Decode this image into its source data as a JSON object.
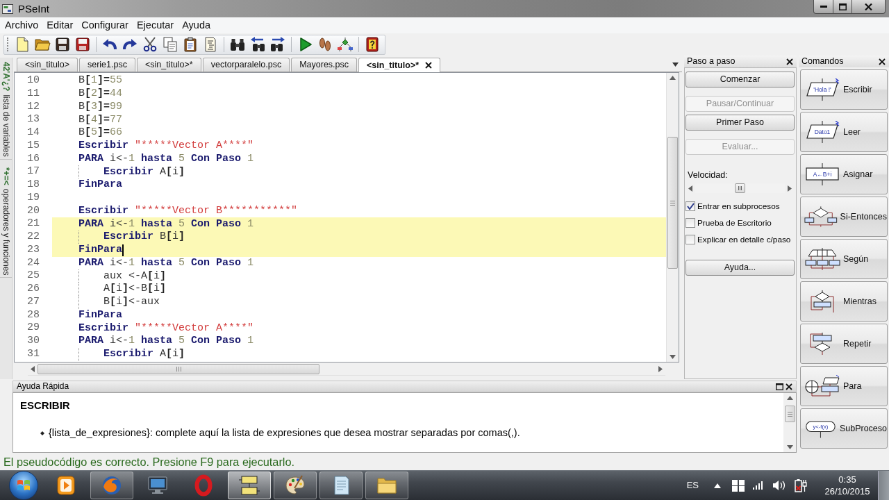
{
  "window": {
    "title": "PSeInt"
  },
  "menu": [
    "Archivo",
    "Editar",
    "Configurar",
    "Ejecutar",
    "Ayuda"
  ],
  "side_panels": [
    {
      "icon_text": "42'A'¿?",
      "label": "lista de variables"
    },
    {
      "icon_text": "*+=<",
      "label": "operadores y funciones"
    }
  ],
  "tabs": [
    {
      "label": "<sin_titulo>",
      "selected": false
    },
    {
      "label": "serie1.psc",
      "selected": false
    },
    {
      "label": "<sin_titulo>*",
      "selected": false
    },
    {
      "label": "vectorparalelo.psc",
      "selected": false
    },
    {
      "label": "Mayores.psc",
      "selected": false
    },
    {
      "label": "<sin_titulo>*",
      "selected": true
    }
  ],
  "editor": {
    "lines": [
      {
        "number": "10",
        "highlighted": false,
        "caret": false,
        "tokens": [
          {
            "text": "B",
            "kind": "plain"
          },
          {
            "text": "[",
            "kind": "operator"
          },
          {
            "text": "1",
            "kind": "number"
          },
          {
            "text": "]=",
            "kind": "operator"
          },
          {
            "text": "55",
            "kind": "number"
          }
        ]
      },
      {
        "number": "11",
        "highlighted": false,
        "caret": false,
        "tokens": [
          {
            "text": "B",
            "kind": "plain"
          },
          {
            "text": "[",
            "kind": "operator"
          },
          {
            "text": "2",
            "kind": "number"
          },
          {
            "text": "]=",
            "kind": "operator"
          },
          {
            "text": "44",
            "kind": "number"
          }
        ]
      },
      {
        "number": "12",
        "highlighted": false,
        "caret": false,
        "tokens": [
          {
            "text": "B",
            "kind": "plain"
          },
          {
            "text": "[",
            "kind": "operator"
          },
          {
            "text": "3",
            "kind": "number"
          },
          {
            "text": "]=",
            "kind": "operator"
          },
          {
            "text": "99",
            "kind": "number"
          }
        ]
      },
      {
        "number": "13",
        "highlighted": false,
        "caret": false,
        "tokens": [
          {
            "text": "B",
            "kind": "plain"
          },
          {
            "text": "[",
            "kind": "operator"
          },
          {
            "text": "4",
            "kind": "number"
          },
          {
            "text": "]=",
            "kind": "operator"
          },
          {
            "text": "77",
            "kind": "number"
          }
        ]
      },
      {
        "number": "14",
        "highlighted": false,
        "caret": false,
        "tokens": [
          {
            "text": "B",
            "kind": "plain"
          },
          {
            "text": "[",
            "kind": "operator"
          },
          {
            "text": "5",
            "kind": "number"
          },
          {
            "text": "]=",
            "kind": "operator"
          },
          {
            "text": "66",
            "kind": "number"
          }
        ]
      },
      {
        "number": "15",
        "highlighted": false,
        "caret": false,
        "tokens": [
          {
            "text": "Escribir",
            "kind": "keyword"
          },
          {
            "text": " \"*****Vector A****\"",
            "kind": "string"
          }
        ]
      },
      {
        "number": "16",
        "highlighted": false,
        "caret": false,
        "tokens": [
          {
            "text": "PARA",
            "kind": "keyword"
          },
          {
            "text": " i<-",
            "kind": "plain"
          },
          {
            "text": "1",
            "kind": "number"
          },
          {
            "text": " hasta",
            "kind": "keyword"
          },
          {
            "text": " 5",
            "kind": "number"
          },
          {
            "text": " Con Paso",
            "kind": "keyword"
          },
          {
            "text": " 1",
            "kind": "number"
          }
        ],
        "children": [
          {
            "number": "17",
            "highlighted": false,
            "caret": false,
            "tokens": [
              {
                "text": "Escribir",
                "kind": "keyword"
              },
              {
                "text": " A",
                "kind": "plain"
              },
              {
                "text": "[",
                "kind": "operator"
              },
              {
                "text": "i",
                "kind": "plain"
              },
              {
                "text": "]",
                "kind": "operator"
              }
            ]
          }
        ]
      },
      {
        "number": "18",
        "highlighted": false,
        "caret": false,
        "tokens": [
          {
            "text": "FinPara",
            "kind": "keyword"
          }
        ]
      },
      {
        "number": "19",
        "highlighted": false,
        "caret": false
      },
      {
        "number": "20",
        "highlighted": false,
        "caret": false,
        "tokens": [
          {
            "text": "Escribir",
            "kind": "keyword"
          },
          {
            "text": " \"*****Vector B***********\"",
            "kind": "string"
          }
        ]
      },
      {
        "number": "21",
        "highlighted": true,
        "caret": false,
        "tokens": [
          {
            "text": "PARA",
            "kind": "keyword"
          },
          {
            "text": " i<-",
            "kind": "plain"
          },
          {
            "text": "1",
            "kind": "number"
          },
          {
            "text": " hasta",
            "kind": "keyword"
          },
          {
            "text": " 5",
            "kind": "number"
          },
          {
            "text": " Con Paso",
            "kind": "keyword"
          },
          {
            "text": " 1",
            "kind": "number"
          }
        ],
        "children": [
          {
            "number": "22",
            "highlighted": true,
            "caret": false,
            "tokens": [
              {
                "text": "Escribir",
                "kind": "keyword"
              },
              {
                "text": " B",
                "kind": "plain"
              },
              {
                "text": "[",
                "kind": "operator"
              },
              {
                "text": "i",
                "kind": "plain"
              },
              {
                "text": "]",
                "kind": "operator"
              }
            ]
          }
        ]
      },
      {
        "number": "23",
        "highlighted": true,
        "caret": true,
        "tokens": [
          {
            "text": "FinPara",
            "kind": "keyword"
          }
        ]
      },
      {
        "number": "24",
        "highlighted": false,
        "caret": false,
        "tokens": [
          {
            "text": "PARA",
            "kind": "keyword"
          },
          {
            "text": " i<-",
            "kind": "plain"
          },
          {
            "text": "1",
            "kind": "number"
          },
          {
            "text": " hasta",
            "kind": "keyword"
          },
          {
            "text": " 5",
            "kind": "number"
          },
          {
            "text": " Con Paso",
            "kind": "keyword"
          },
          {
            "text": " 1",
            "kind": "number"
          }
        ],
        "children": [
          {
            "number": "25",
            "highlighted": false,
            "caret": false,
            "tokens": [
              {
                "text": "aux <-A",
                "kind": "plain"
              },
              {
                "text": "[",
                "kind": "operator"
              },
              {
                "text": "i",
                "kind": "plain"
              },
              {
                "text": "]",
                "kind": "operator"
              }
            ]
          },
          {
            "number": "26",
            "highlighted": false,
            "caret": false,
            "tokens": [
              {
                "text": "A",
                "kind": "plain"
              },
              {
                "text": "[",
                "kind": "operator"
              },
              {
                "text": "i",
                "kind": "plain"
              },
              {
                "text": "]",
                "kind": "operator"
              },
              {
                "text": "<-B",
                "kind": "plain"
              },
              {
                "text": "[",
                "kind": "operator"
              },
              {
                "text": "i",
                "kind": "plain"
              },
              {
                "text": "]",
                "kind": "operator"
              }
            ]
          },
          {
            "number": "27",
            "highlighted": false,
            "caret": false,
            "tokens": [
              {
                "text": "B",
                "kind": "plain"
              },
              {
                "text": "[",
                "kind": "operator"
              },
              {
                "text": "i",
                "kind": "plain"
              },
              {
                "text": "]",
                "kind": "operator"
              },
              {
                "text": "<-aux",
                "kind": "plain"
              }
            ]
          }
        ]
      },
      {
        "number": "28",
        "highlighted": false,
        "caret": false,
        "tokens": [
          {
            "text": "FinPara",
            "kind": "keyword"
          }
        ]
      },
      {
        "number": "29",
        "highlighted": false,
        "caret": false,
        "tokens": [
          {
            "text": "Escribir",
            "kind": "keyword"
          },
          {
            "text": " \"*****Vector A****\"",
            "kind": "string"
          }
        ]
      },
      {
        "number": "30",
        "highlighted": false,
        "caret": false,
        "tokens": [
          {
            "text": "PARA",
            "kind": "keyword"
          },
          {
            "text": " i<-",
            "kind": "plain"
          },
          {
            "text": "1",
            "kind": "number"
          },
          {
            "text": " hasta",
            "kind": "keyword"
          },
          {
            "text": " 5",
            "kind": "number"
          },
          {
            "text": " Con Paso",
            "kind": "keyword"
          },
          {
            "text": " 1",
            "kind": "number"
          }
        ],
        "children": [
          {
            "number": "31",
            "highlighted": false,
            "caret": false,
            "tokens": [
              {
                "text": "Escribir",
                "kind": "keyword"
              },
              {
                "text": " A",
                "kind": "plain"
              },
              {
                "text": "[",
                "kind": "operator"
              },
              {
                "text": "i",
                "kind": "plain"
              },
              {
                "text": "]",
                "kind": "operator"
              }
            ]
          }
        ]
      }
    ]
  },
  "step_panel": {
    "title": "Paso a paso",
    "buttons": [
      {
        "label": "Comenzar",
        "disabled": false
      },
      {
        "label": "Pausar/Continuar",
        "disabled": true
      },
      {
        "label": "Primer Paso",
        "disabled": false
      },
      {
        "label": "Evaluar...",
        "disabled": true
      }
    ],
    "speed": {
      "label": "Velocidad:",
      "level": 0.5
    },
    "options": [
      {
        "label": "Entrar en subprocesos",
        "checked": true
      },
      {
        "label": "Prueba de Escritorio",
        "checked": false
      },
      {
        "label": "Explicar en detalle c/paso",
        "checked": false
      }
    ],
    "help_button": {
      "label": "Ayuda..."
    }
  },
  "commands_panel": {
    "title": "Comandos",
    "commands": [
      {
        "kind": "escribir",
        "label": "Escribir",
        "icon_text": "'Hola !'"
      },
      {
        "kind": "leer",
        "label": "Leer",
        "icon_text": "Dato1"
      },
      {
        "kind": "asignar",
        "label": "Asignar",
        "icon_text": "A←B+i"
      },
      {
        "kind": "si",
        "label": "Si-Entonces"
      },
      {
        "kind": "segun",
        "label": "Según"
      },
      {
        "kind": "mientras",
        "label": "Mientras"
      },
      {
        "kind": "repetir",
        "label": "Repetir"
      },
      {
        "kind": "para",
        "label": "Para"
      },
      {
        "kind": "subproceso",
        "label": "SubProceso",
        "icon_text": "y<-f(x)"
      }
    ]
  },
  "quick_help": {
    "title": "Ayuda Rápida",
    "heading": "ESCRIBIR",
    "items": [
      "{lista_de_expresiones}: complete aquí la lista de expresiones que desea mostrar separadas por comas(,)."
    ]
  },
  "status_bar": {
    "message": "El pseudocódigo es correcto. Presione F9 para ejecutarlo."
  },
  "taskbar": {
    "apps": [
      {
        "kind": "player",
        "running": false,
        "active": false
      },
      {
        "kind": "browser",
        "running": true,
        "active": false
      },
      {
        "kind": "monitor",
        "running": false,
        "active": false
      },
      {
        "kind": "ring",
        "running": false,
        "active": false
      },
      {
        "kind": "flowchart",
        "running": true,
        "active": true
      },
      {
        "kind": "palette",
        "running": true,
        "active": false
      },
      {
        "kind": "notepad",
        "running": true,
        "active": false
      },
      {
        "kind": "folder",
        "running": true,
        "active": false
      }
    ],
    "tray": {
      "language": "ES",
      "time": "0:35",
      "date": "26/10/2015"
    }
  }
}
